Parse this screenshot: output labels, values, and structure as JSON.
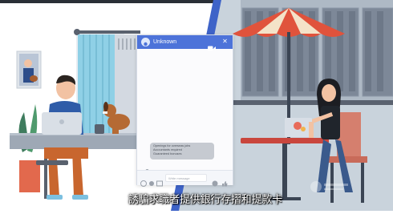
{
  "chat": {
    "contact_name": "Unknown",
    "message_lines": [
      "Openings for overseas jobs",
      "Accountants required",
      "Guaranteed bonuses"
    ],
    "input_placeholder": "Write message",
    "header_color": "#4d73d9"
  },
  "subtitle": "誘騙求職者提供銀行存摺和提款卡",
  "icons": [
    "video-icon",
    "close-icon",
    "user-icon",
    "emoji-icon",
    "attach-icon",
    "send-icon",
    "like-icon"
  ]
}
